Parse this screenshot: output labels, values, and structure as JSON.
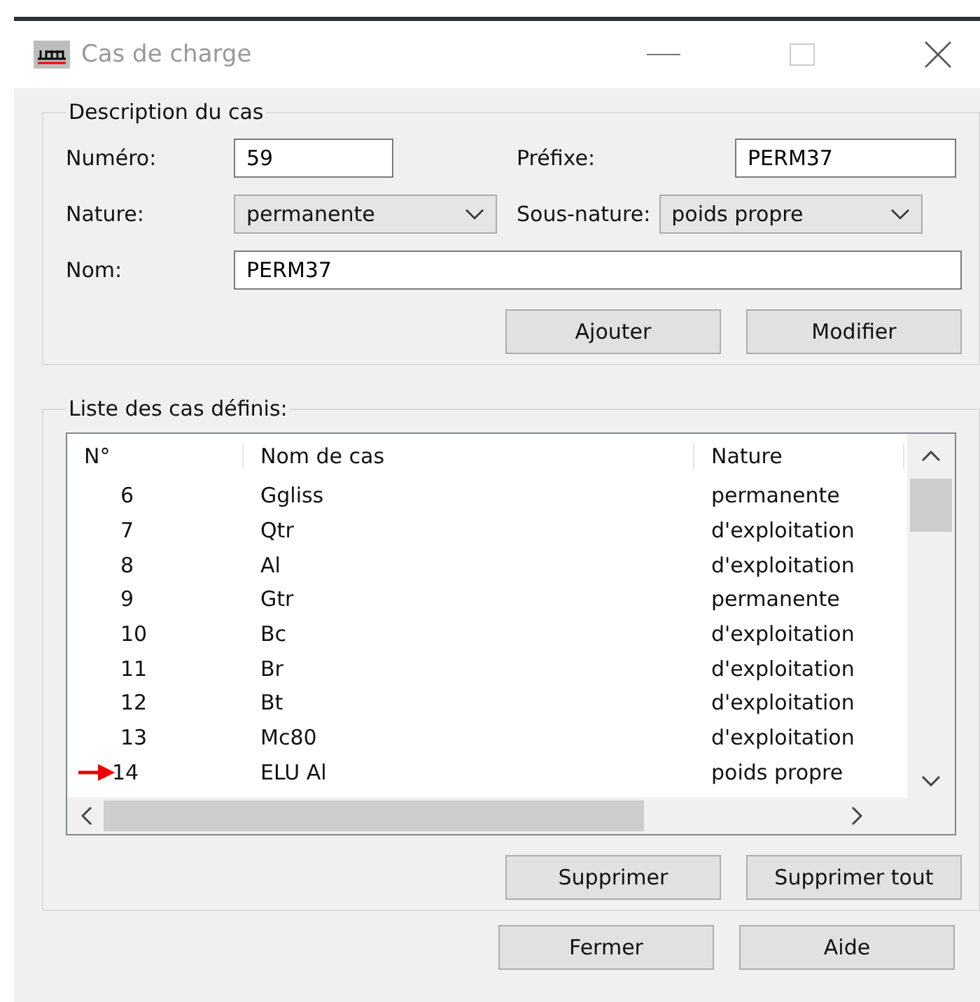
{
  "window": {
    "title": "Cas de charge"
  },
  "description": {
    "title": "Description du cas",
    "numero_label": "Numéro:",
    "numero": "59",
    "prefixe_label": "Préfixe:",
    "prefixe": "PERM37",
    "nature_label": "Nature:",
    "nature": "permanente",
    "sous_nature_label": "Sous-nature:",
    "sous_nature": "poids propre",
    "nom_label": "Nom:",
    "nom": "PERM37",
    "buttons": [
      "Ajouter",
      "Modifier"
    ]
  },
  "list": {
    "title": "Liste des cas définis:",
    "columns": [
      "N°",
      "Nom de cas",
      "Nature"
    ],
    "rows": [
      {
        "n": "6",
        "name": "Ggliss",
        "nature": "permanente",
        "marked": false
      },
      {
        "n": "7",
        "name": "Qtr",
        "nature": "d'exploitation",
        "marked": false
      },
      {
        "n": "8",
        "name": "Al",
        "nature": "d'exploitation",
        "marked": false
      },
      {
        "n": "9",
        "name": "Gtr",
        "nature": "permanente",
        "marked": false
      },
      {
        "n": "10",
        "name": "Bc",
        "nature": "d'exploitation",
        "marked": false
      },
      {
        "n": "11",
        "name": "Br",
        "nature": "d'exploitation",
        "marked": false
      },
      {
        "n": "12",
        "name": "Bt",
        "nature": "d'exploitation",
        "marked": false
      },
      {
        "n": "13",
        "name": "Mc80",
        "nature": "d'exploitation",
        "marked": false
      },
      {
        "n": "14",
        "name": "ELU Al",
        "nature": "poids propre",
        "marked": true
      }
    ],
    "buttons": [
      "Supprimer",
      "Supprimer tout"
    ]
  },
  "footer_buttons": [
    "Fermer",
    "Aide"
  ]
}
